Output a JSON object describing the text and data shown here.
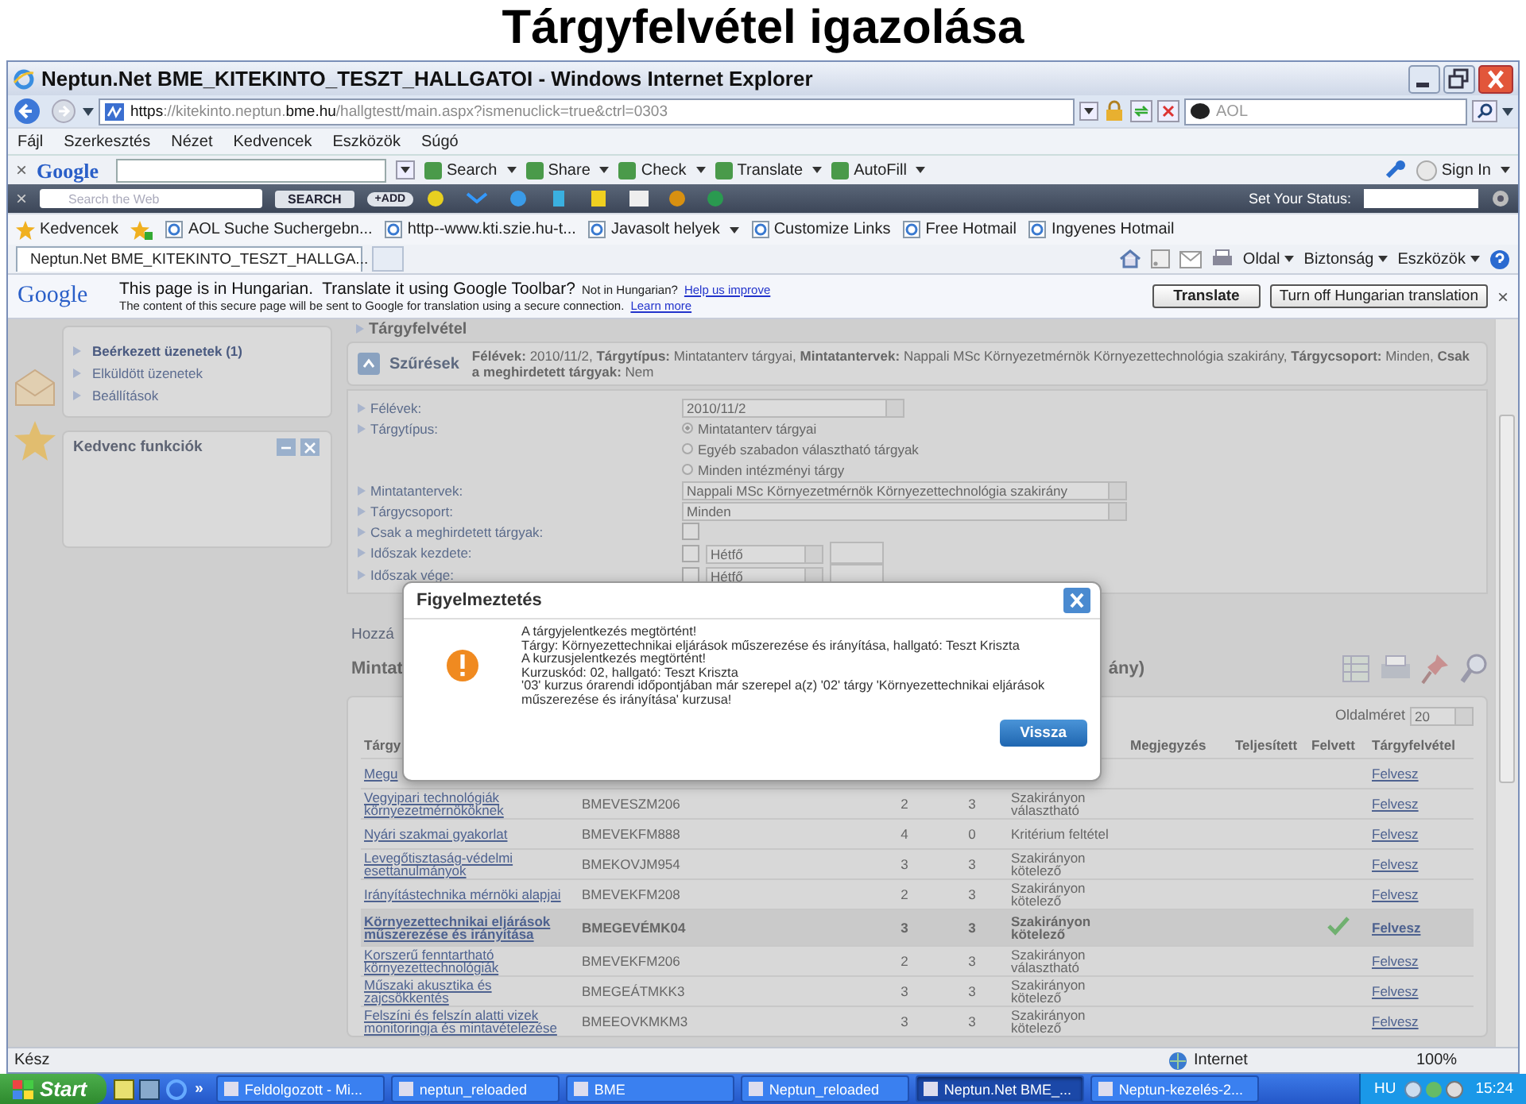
{
  "caption": "Tárgyfelvétel igazolása",
  "window": {
    "title": "Neptun.Net BME_KITEKINTO_TESZT_HALLGATOI - Windows Internet Explorer"
  },
  "address_bar": {
    "url": [
      {
        "text": "https",
        "strong": true
      },
      {
        "text": "://kitekinto.neptun.",
        "strong": false
      },
      {
        "text": "bme.hu",
        "strong": true
      },
      {
        "text": "/hallgtestt/main.aspx?ismenuclick=true&ctrl=0303",
        "strong": false
      }
    ],
    "search_value": "AOL"
  },
  "menu": [
    "Fájl",
    "Szerkesztés",
    "Nézet",
    "Kedvencek",
    "Eszközök",
    "Súgó"
  ],
  "google_toolbar": {
    "close": "×",
    "logo": "Google",
    "buttons": [
      "Search",
      "Share",
      "Check",
      "Translate",
      "AutoFill"
    ],
    "sign_in": "Sign In"
  },
  "aol_toolbar": {
    "close": "×",
    "search_placeholder": "Search the Web",
    "search_button": "SEARCH",
    "add_button": "+ADD",
    "status_label": "Set Your Status:"
  },
  "favorites_bar": {
    "label": "Kedvencek",
    "links": [
      {
        "label": "AOL Suche Suchergebn...",
        "dropdown": false
      },
      {
        "label": "http--www.kti.szie.hu-t...",
        "dropdown": false
      },
      {
        "label": "Javasolt helyek",
        "dropdown": true
      },
      {
        "label": "Customize Links",
        "dropdown": false
      },
      {
        "label": "Free Hotmail",
        "dropdown": false
      },
      {
        "label": "Ingyenes Hotmail",
        "dropdown": false
      }
    ]
  },
  "tab_bar": {
    "tab": "Neptun.Net BME_KITEKINTO_TESZT_HALLGA...",
    "commands": [
      "Oldal",
      "Biztonság",
      "Eszközök"
    ]
  },
  "translate_bar": {
    "logo": "Google",
    "message": "This page is in Hungarian.  Translate it using Google Toolbar?",
    "not_language": "Not in Hungarian?",
    "improve_link": "Help us improve",
    "note": "The content of this secure page will be sent to Google for translation using a secure connection.",
    "learn_link": "Learn more",
    "translate_button": "Translate",
    "turn_off_button": "Turn off Hungarian translation",
    "close": "×"
  },
  "sidebar": {
    "messages": [
      {
        "label": "Beérkezett üzenetek (1)",
        "unread": true
      },
      {
        "label": "Elküldött üzenetek",
        "unread": false
      },
      {
        "label": "Beállítások",
        "unread": false
      }
    ],
    "favorites_title": "Kedvenc funkciók"
  },
  "breadcrumb": "Tárgyfelvétel",
  "filter": {
    "button": "Szűrések",
    "summary": "**Félévek:** 2010/11/2, **Tárgytípus:** Mintatanterv tárgyai, **Mintatantervek:** Nappali MSc Környezetmérnök Környezettechnológia szakirány, **Tárgycsoport:** Minden, **Csak a meghirdetett tárgyak:** Nem",
    "fields": [
      {
        "kind": "select",
        "label": "Félévek:",
        "value": "2010/11/2",
        "wide": false
      },
      {
        "kind": "radio",
        "label": "Tárgytípus:",
        "options": [
          {
            "label": "Mintatanterv tárgyai",
            "selected": true
          },
          {
            "label": "Egyéb szabadon választható tárgyak",
            "selected": false
          },
          {
            "label": "Minden intézményi tárgy",
            "selected": false
          }
        ]
      },
      {
        "kind": "select",
        "label": "Mintatantervek:",
        "value": "Nappali MSc Környezetmérnök Környezettechnológia szakirány",
        "wide": true
      },
      {
        "kind": "select",
        "label": "Tárgycsoport:",
        "value": "Minden",
        "wide": true
      },
      {
        "kind": "checkbox",
        "label": "Csak a meghirdetett tárgyak:",
        "checked": false
      },
      {
        "kind": "period",
        "label": "Időszak kezdete:",
        "checked": false,
        "day": "Hétfő"
      },
      {
        "kind": "period",
        "label": "Időszak vége:",
        "checked": false,
        "day": "Hétfő"
      }
    ]
  },
  "add_link": "Hozzá",
  "section_title_start": "Mintat",
  "section_title_end": "ány)",
  "table": {
    "page_size_label": "Oldalméret",
    "page_size": "20",
    "header": {
      "name": "Tárgy",
      "remark": "Megjegyzés",
      "completed": "Teljesített",
      "taken": "Felvett",
      "enroll": "Tárgyfelvétel"
    },
    "rows": [
      {
        "name": "Megu",
        "link": "Felvesz",
        "taken": false,
        "selected": false
      },
      {
        "name": "Vegyipari technológiák környezetmérnököknek",
        "code": "BMEVESZM206",
        "credits": "2",
        "column_4": "3",
        "type": "Szakirányon választható",
        "link": "Felvesz",
        "taken": false,
        "selected": false
      },
      {
        "name": "Nyári szakmai gyakorlat",
        "code": "BMEVEKFM888",
        "credits": "4",
        "column_4": "0",
        "type": "Kritérium feltétel",
        "link": "Felvesz",
        "taken": false,
        "selected": false
      },
      {
        "name": "Levegőtisztaság-védelmi esettanulmányok",
        "code": "BMEKOVJM954",
        "credits": "3",
        "column_4": "3",
        "type": "Szakirányon kötelező",
        "link": "Felvesz",
        "taken": false,
        "selected": false
      },
      {
        "name": "Irányítástechnika mérnöki alapjai",
        "code": "BMEVEKFM208",
        "credits": "2",
        "column_4": "3",
        "type": "Szakirányon kötelező",
        "link": "Felvesz",
        "taken": false,
        "selected": false
      },
      {
        "name": "Környezettechnikai eljárások műszerezése és irányítása",
        "code": "BMEGEVÉMK04",
        "credits": "3",
        "column_4": "3",
        "type": "Szakirányon kötelező",
        "link": "Felvesz",
        "taken": true,
        "selected": true
      },
      {
        "name": "Korszerű fenntartható környezettechnológiák",
        "code": "BMEVEKFM206",
        "credits": "2",
        "column_4": "3",
        "type": "Szakirányon választható",
        "link": "Felvesz",
        "taken": false,
        "selected": false
      },
      {
        "name": "Műszaki akusztika és zajcsökkentés",
        "code": "BMEGEÁTMKK3",
        "credits": "3",
        "column_4": "3",
        "type": "Szakirányon kötelező",
        "link": "Felvesz",
        "taken": false,
        "selected": false
      },
      {
        "name": "Felszíni és felszín alatti vizek monitoringja és mintavételezése",
        "code": "BMEEOVKMKM3",
        "credits": "3",
        "column_4": "3",
        "type": "Szakirányon kötelező",
        "link": "Felvesz",
        "taken": false,
        "selected": false
      }
    ]
  },
  "dialog": {
    "title": "Figyelmeztetés",
    "lines": [
      "A tárgyjelentkezés megtörtént!",
      "Tárgy: Környezettechnikai eljárások műszerezése és irányítása, hallgató: Teszt Kriszta",
      "A kurzusjelentkezés megtörtént!",
      "Kurzuskód: 02, hallgató: Teszt Kriszta",
      "'03' kurzus órarendi időpontjában már szerepel a(z) '02' tárgy 'Környezettechnikai eljárások műszerezése és irányítása' kurzusa!"
    ],
    "button": "Vissza"
  },
  "status_bar": {
    "text": "Kész",
    "zone": "Internet",
    "zoom": "100%"
  },
  "taskbar": {
    "start": "Start",
    "more": "»",
    "tasks": [
      {
        "label": "Feldolgozott - Mi...",
        "selected": false
      },
      {
        "label": "neptun_reloaded",
        "selected": false
      },
      {
        "label": "BME",
        "selected": false
      },
      {
        "label": "Neptun_reloaded",
        "selected": false
      },
      {
        "label": "Neptun.Net BME_...",
        "selected": true
      },
      {
        "label": "Neptun-kezelés-2...",
        "selected": false
      }
    ],
    "language": "HU",
    "clock": "15:24"
  }
}
